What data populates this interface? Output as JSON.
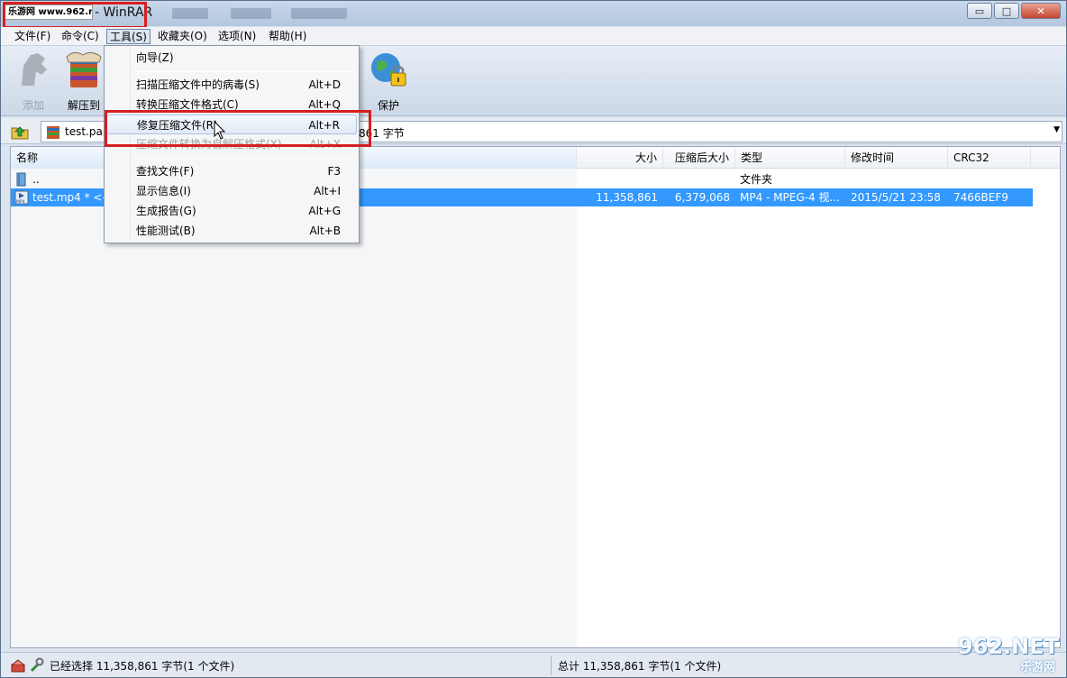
{
  "window": {
    "badge_text": "乐游网 www.962.net",
    "app_title": "- WinRAR",
    "minimize": "▭",
    "maximize": "□",
    "close": "✕"
  },
  "menubar": {
    "items": [
      "文件(F)",
      "命令(C)",
      "工具(S)",
      "收藏夹(O)",
      "选项(N)",
      "帮助(H)"
    ],
    "open_item": "工具(S)"
  },
  "toolbar": {
    "add_label": "添加",
    "extract_label": "解压到",
    "protect_label": "保护"
  },
  "address": {
    "text": "test.par",
    "tail": "861 字节"
  },
  "columns": {
    "name": "名称",
    "size": "大小",
    "packed": "压缩后大小",
    "type": "类型",
    "modified": "修改时间",
    "crc": "CRC32"
  },
  "rows": [
    {
      "name": "..",
      "size": "",
      "packed": "",
      "type": "文件夹",
      "modified": "",
      "crc": "",
      "icon": "folder-icon"
    },
    {
      "name": "test.mp4 * <--",
      "size": "11,358,861",
      "packed": "6,379,068",
      "type": "MP4 - MPEG-4 视...",
      "modified": "2015/5/21 23:58",
      "crc": "7466BEF9",
      "icon": "mp4-file-icon"
    }
  ],
  "tools_menu": {
    "wizard": {
      "label": "向导(Z)",
      "shortcut": ""
    },
    "scan": {
      "label": "扫描压缩文件中的病毒(S)",
      "shortcut": "Alt+D"
    },
    "convert": {
      "label": "转换压缩文件格式(C)",
      "shortcut": "Alt+Q"
    },
    "repair": {
      "label": "修复压缩文件(R)",
      "shortcut": "Alt+R"
    },
    "sfx": {
      "label": "压缩文件转换为自解压格式(X)",
      "shortcut": "Alt+X"
    },
    "find": {
      "label": "查找文件(F)",
      "shortcut": "F3"
    },
    "info": {
      "label": "显示信息(I)",
      "shortcut": "Alt+I"
    },
    "report": {
      "label": "生成报告(G)",
      "shortcut": "Alt+G"
    },
    "benchmark": {
      "label": "性能测试(B)",
      "shortcut": "Alt+B"
    }
  },
  "status": {
    "left": "已经选择 11,358,861 字节(1 个文件)",
    "right": "总计 11,358,861 字节(1 个文件)"
  },
  "watermark": {
    "big": "962.NET",
    "small": "乐游网"
  },
  "colors": {
    "highlight_red": "#d42020",
    "selection_blue": "#3399ff"
  }
}
